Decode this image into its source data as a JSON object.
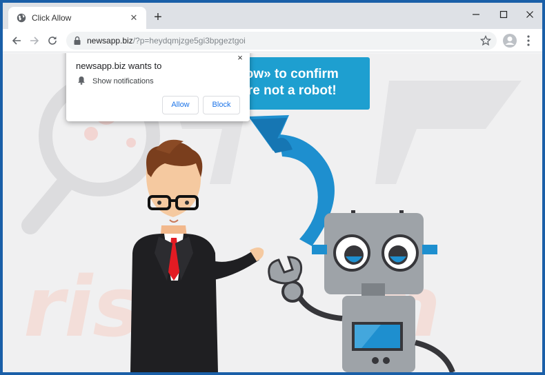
{
  "browser": {
    "tab_title": "Click Allow",
    "new_tab_symbol": "+",
    "url_host": "newsapp.biz",
    "url_rest": "/?p=heydqmjzge5gi3bpgeztgoi"
  },
  "popup": {
    "title": "newsapp.biz wants to",
    "permission": "Show notifications",
    "allow_label": "Allow",
    "block_label": "Block",
    "close_symbol": "×"
  },
  "page": {
    "banner_line1": "llow» to confirm",
    "banner_line2": "are not a robot!"
  },
  "icons": {
    "tab_favicon": "globe-icon",
    "lock": "lock-icon",
    "bookmark": "star-icon",
    "profile": "account-icon",
    "menu": "kebab-menu-icon",
    "notification": "bell-icon"
  },
  "colors": {
    "frame": "#1a5fa8",
    "banner": "#1e9fd0",
    "arrow": "#1e8fcf",
    "button_text": "#1a73e8"
  }
}
